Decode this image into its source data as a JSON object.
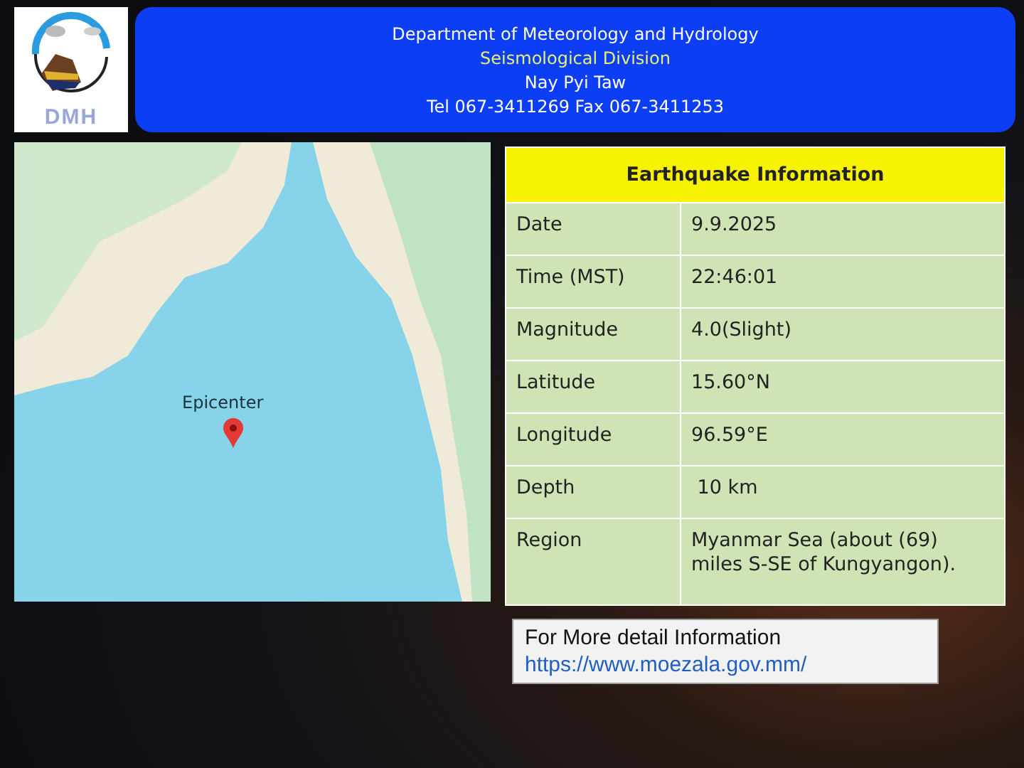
{
  "header": {
    "logo_text": "DMH",
    "lines": [
      {
        "text": "Department of Meteorology and Hydrology",
        "kind": "plain"
      },
      {
        "text": "Seismological Division",
        "kind": "accent"
      },
      {
        "text": "Nay Pyi Taw",
        "kind": "plain"
      },
      {
        "text": "Tel 067-3411269 Fax 067-3411253",
        "kind": "plain"
      }
    ]
  },
  "map": {
    "marker_label": "Epicenter"
  },
  "info_table": {
    "title": "Earthquake Information",
    "rows": [
      {
        "label": "Date",
        "value": "9.9.2025"
      },
      {
        "label": "Time (MST)",
        "value": "22:46:01"
      },
      {
        "label": "Magnitude",
        "value": "4.0(Slight)"
      },
      {
        "label": "Latitude",
        "value": "15.60°N"
      },
      {
        "label": "Longitude",
        "value": "96.59°E"
      },
      {
        "label": "Depth",
        "value": " 10 km"
      },
      {
        "label": "Region",
        "value": "Myanmar Sea (about (69) miles S-SE of Kungyangon)."
      }
    ]
  },
  "more_info": {
    "text": "For More detail Information",
    "link": "https://www.moezala.gov.mm/"
  }
}
